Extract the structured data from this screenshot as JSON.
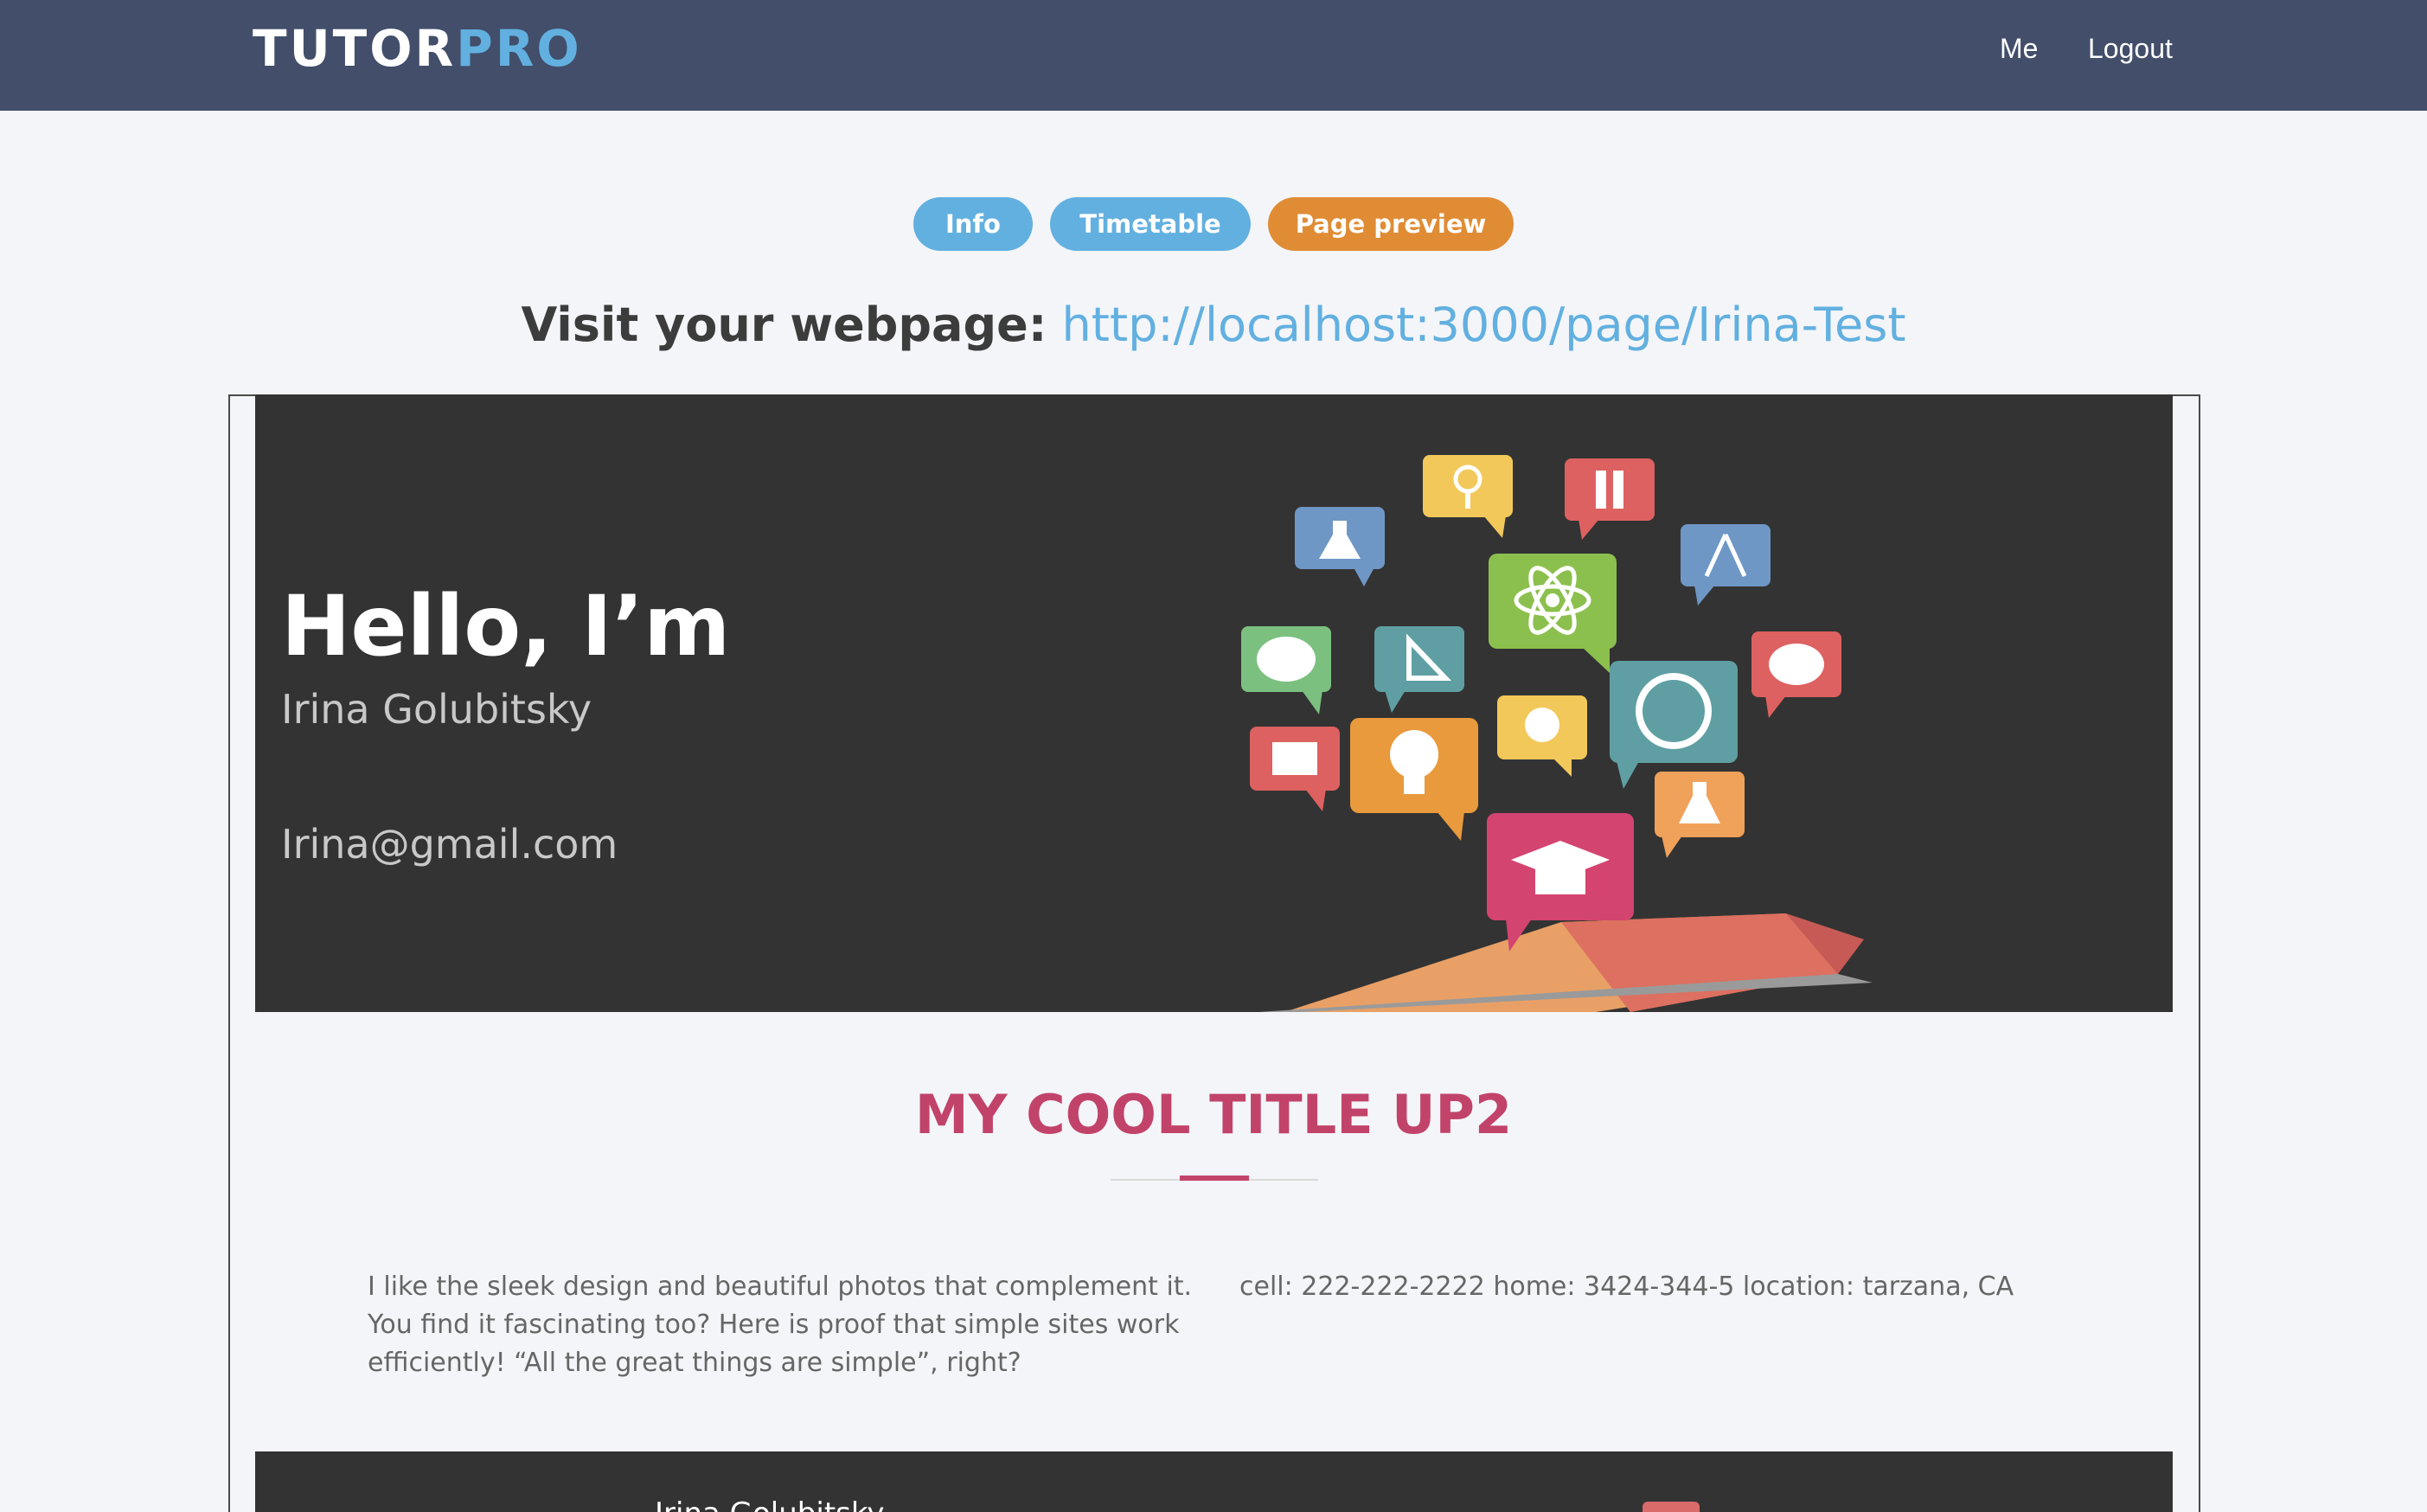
{
  "navbar": {
    "logo_part1": "TUTOR",
    "logo_part2": "PRO",
    "links": [
      "Me",
      "Logout"
    ]
  },
  "tabs": [
    "Info",
    "Timetable",
    "Page preview"
  ],
  "visit": {
    "label": "Visit your webpage:",
    "url": "http://localhost:3000/page/Irina-Test"
  },
  "hero": {
    "greeting": "Hello, I’m",
    "name": "Irina Golubitsky",
    "email": "Irina@gmail.com"
  },
  "section": {
    "title": "MY COOL TITLE UP2",
    "about": "I like the sleek design and beautiful photos that complement it. You find it fascinating too? Here is proof that simple sites work efficiently! “All the great things are simple”, right?",
    "contact": "cell: 222-222-2222 home: 3424-344-5 location: tarzana, CA"
  },
  "footer": {
    "name": "Irina Golubitsky"
  },
  "colors": {
    "navbar": "#424e6a",
    "accent_blue": "#62b0e0",
    "accent_orange": "#e08c35",
    "title_pink": "#c2436a",
    "hero_bg": "#333333"
  }
}
